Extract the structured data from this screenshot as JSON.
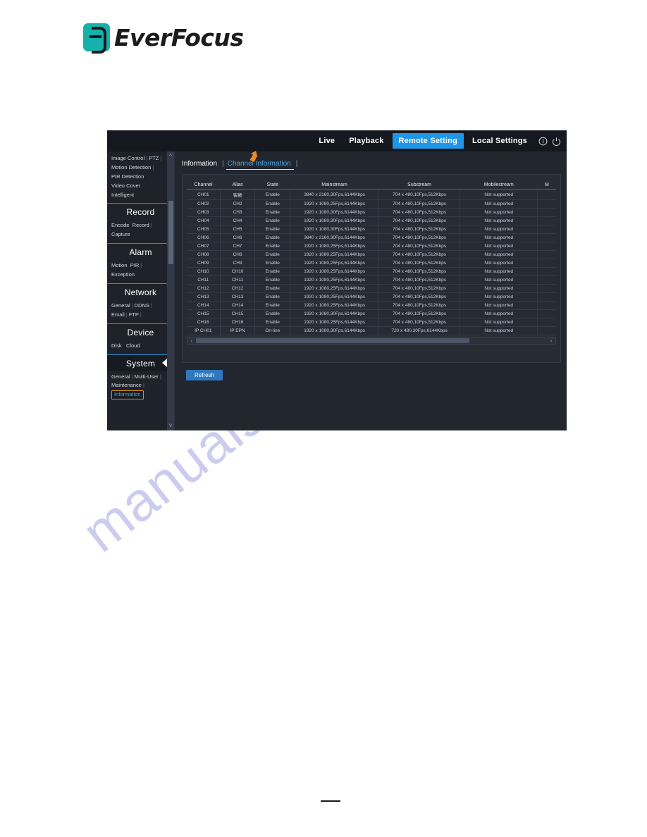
{
  "brand": {
    "name": "EverFocus",
    "logo_color": "#18b0ac"
  },
  "watermark": {
    "text": "manualshive.com"
  },
  "topnav": {
    "items": [
      {
        "label": "Live",
        "active": false
      },
      {
        "label": "Playback",
        "active": false
      },
      {
        "label": "Remote Setting",
        "active": true
      },
      {
        "label": "Local Settings",
        "active": false
      }
    ],
    "icons": [
      {
        "name": "info-icon",
        "glyph": "i"
      },
      {
        "name": "power-icon",
        "glyph": "power"
      }
    ],
    "accent_color": "#2196e8"
  },
  "sidebar": {
    "top_links": [
      {
        "row": [
          "Image Control",
          "PTZ"
        ]
      },
      {
        "row": [
          "Motion Detection"
        ]
      },
      {
        "row": [
          "PIR Detection"
        ]
      },
      {
        "row": [
          "Video Cover"
        ]
      },
      {
        "row": [
          "Intelligent"
        ]
      }
    ],
    "sections": [
      {
        "title": "Record",
        "active": false,
        "links": [
          {
            "row": [
              "Encode",
              "Record"
            ]
          },
          {
            "row": [
              "Capture"
            ]
          }
        ]
      },
      {
        "title": "Alarm",
        "active": false,
        "links": [
          {
            "row": [
              "Motion",
              "PIR"
            ]
          },
          {
            "row": [
              "Exception"
            ]
          }
        ]
      },
      {
        "title": "Network",
        "active": false,
        "links": [
          {
            "row": [
              "General",
              "DDNS"
            ]
          },
          {
            "row": [
              "Email",
              "FTP"
            ]
          }
        ]
      },
      {
        "title": "Device",
        "active": false,
        "links": [
          {
            "row": [
              "Disk",
              "Cloud"
            ]
          }
        ]
      },
      {
        "title": "System",
        "active": true,
        "links": [
          {
            "row": [
              "General",
              "Multi-User"
            ]
          },
          {
            "row": [
              "Maintenance"
            ]
          },
          {
            "row": [
              "Information"
            ],
            "highlighted": true
          }
        ]
      }
    ],
    "highlight_border_color": "#e08b20"
  },
  "tabs": [
    {
      "label": "Information",
      "active": false
    },
    {
      "label": "Channel Information",
      "active": true
    }
  ],
  "table": {
    "headers": [
      "Channel",
      "Alias",
      "State",
      "Mainstream",
      "Substream",
      "Mobilestream",
      "M"
    ],
    "rows": [
      {
        "channel": "CH01",
        "alias": "客廳",
        "alias_cjk": true,
        "state": "Enable",
        "mainstream": "3840 x 2160,30Fps,6144Kbps",
        "substream": "704 x 480,10Fps,512Kbps",
        "mobilestream": "Not supported"
      },
      {
        "channel": "CH02",
        "alias": "CH2",
        "state": "Enable",
        "mainstream": "1920 x 1080,25Fps,6144Kbps",
        "substream": "704 x 480,10Fps,512Kbps",
        "mobilestream": "Not supported"
      },
      {
        "channel": "CH03",
        "alias": "CH3",
        "state": "Enable",
        "mainstream": "1920 x 1080,30Fps,6144Kbps",
        "substream": "704 x 480,10Fps,512Kbps",
        "mobilestream": "Not supported"
      },
      {
        "channel": "CH04",
        "alias": "CH4",
        "state": "Enable",
        "mainstream": "1920 x 1080,30Fps,6144Kbps",
        "substream": "704 x 480,10Fps,512Kbps",
        "mobilestream": "Not supported"
      },
      {
        "channel": "CH05",
        "alias": "CH5",
        "state": "Enable",
        "mainstream": "1920 x 1080,30Fps,6144Kbps",
        "substream": "704 x 480,10Fps,512Kbps",
        "mobilestream": "Not supported"
      },
      {
        "channel": "CH06",
        "alias": "CH6",
        "state": "Enable",
        "mainstream": "3840 x 2160,30Fps,6144Kbps",
        "substream": "704 x 480,10Fps,512Kbps",
        "mobilestream": "Not supported"
      },
      {
        "channel": "CH07",
        "alias": "CH7",
        "state": "Enable",
        "mainstream": "1920 x 1080,25Fps,6144Kbps",
        "substream": "704 x 480,10Fps,512Kbps",
        "mobilestream": "Not supported"
      },
      {
        "channel": "CH08",
        "alias": "CH8",
        "state": "Enable",
        "mainstream": "1920 x 1080,25Fps,6144Kbps",
        "substream": "704 x 480,10Fps,512Kbps",
        "mobilestream": "Not supported"
      },
      {
        "channel": "CH09",
        "alias": "CH9",
        "state": "Enable",
        "mainstream": "1920 x 1080,25Fps,6144Kbps",
        "substream": "704 x 480,10Fps,512Kbps",
        "mobilestream": "Not supported"
      },
      {
        "channel": "CH10",
        "alias": "CH10",
        "state": "Enable",
        "mainstream": "1920 x 1080,25Fps,6144Kbps",
        "substream": "704 x 480,10Fps,512Kbps",
        "mobilestream": "Not supported"
      },
      {
        "channel": "CH11",
        "alias": "CH11",
        "state": "Enable",
        "mainstream": "1920 x 1080,25Fps,6144Kbps",
        "substream": "704 x 480,10Fps,512Kbps",
        "mobilestream": "Not supported"
      },
      {
        "channel": "CH12",
        "alias": "CH12",
        "state": "Enable",
        "mainstream": "1920 x 1080,25Fps,6144Kbps",
        "substream": "704 x 480,10Fps,512Kbps",
        "mobilestream": "Not supported"
      },
      {
        "channel": "CH13",
        "alias": "CH13",
        "state": "Enable",
        "mainstream": "1920 x 1080,25Fps,6144Kbps",
        "substream": "704 x 480,10Fps,512Kbps",
        "mobilestream": "Not supported"
      },
      {
        "channel": "CH14",
        "alias": "CH14",
        "state": "Enable",
        "mainstream": "1920 x 1080,25Fps,6144Kbps",
        "substream": "704 x 480,10Fps,512Kbps",
        "mobilestream": "Not supported"
      },
      {
        "channel": "CH15",
        "alias": "CH15",
        "state": "Enable",
        "mainstream": "1920 x 1080,30Fps,6144Kbps",
        "substream": "704 x 480,10Fps,512Kbps",
        "mobilestream": "Not supported"
      },
      {
        "channel": "CH16",
        "alias": "CH16",
        "state": "Enable",
        "mainstream": "1920 x 1080,25Fps,6144Kbps",
        "substream": "704 x 480,10Fps,512Kbps",
        "mobilestream": "Not supported"
      },
      {
        "channel": "IP CH01",
        "alias": "IP EPN",
        "state": "On-line",
        "mainstream": "1920 x 1080,30Fps,6144Kbps",
        "substream": "720 x 480,30Fps,6144Kbps",
        "mobilestream": "Not supported"
      }
    ]
  },
  "buttons": {
    "refresh": "Refresh"
  },
  "scrollbar": {
    "left_arrow": "‹",
    "right_arrow": "›",
    "up_arrow": "^",
    "down_arrow": "v"
  }
}
